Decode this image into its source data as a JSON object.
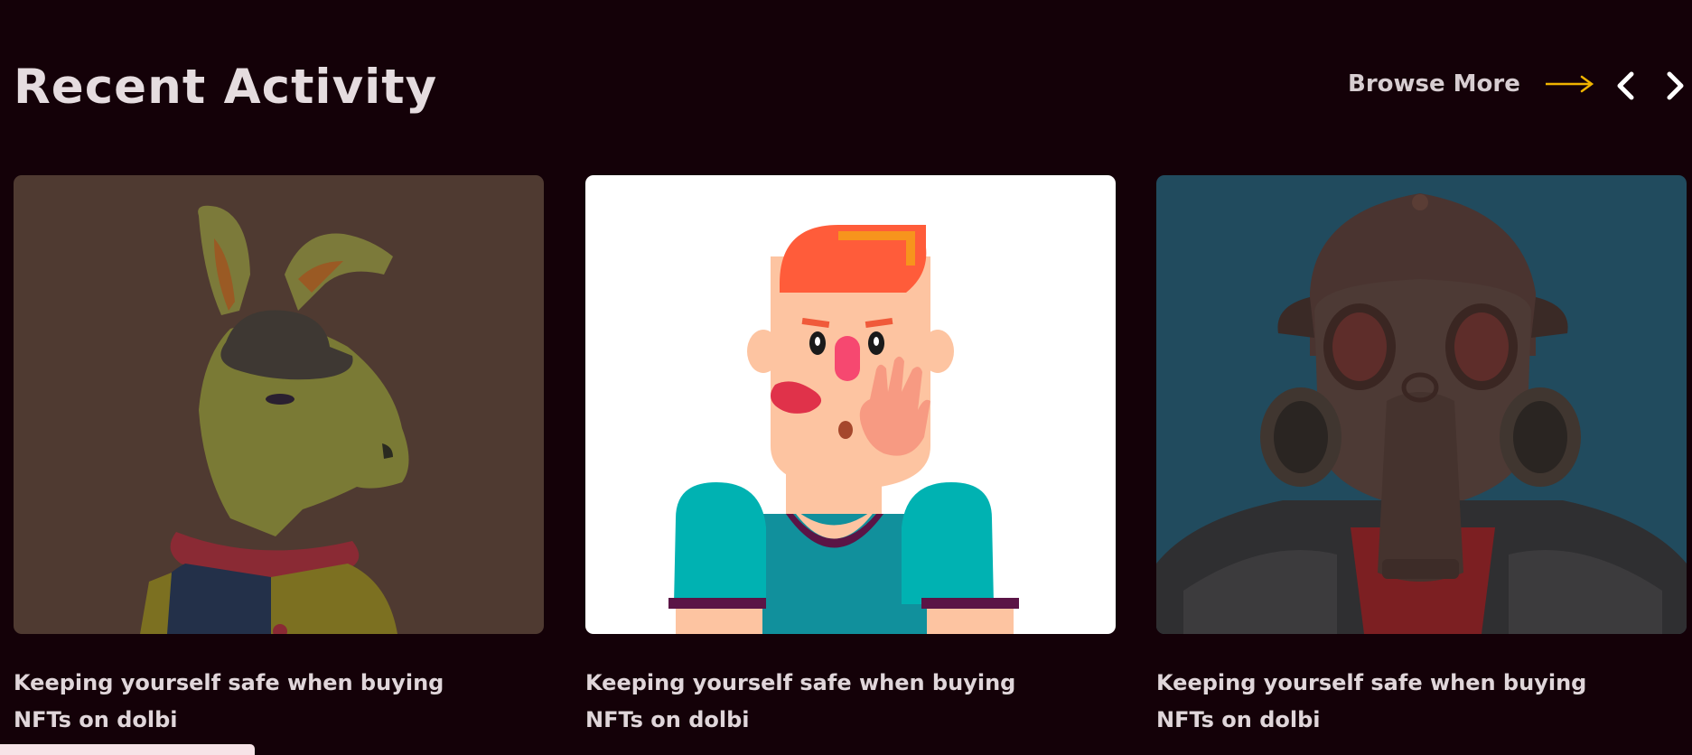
{
  "section": {
    "title": "Recent Activity",
    "browse_more_label": "Browse More",
    "accent_color": "#f0b400"
  },
  "icons": {
    "browse_arrow": "long-right-arrow-icon",
    "prev": "chevron-left-icon",
    "next": "chevron-right-icon"
  },
  "cards": [
    {
      "title": "Keeping yourself safe when buying NFTs on dolbi",
      "image": "rabbit-nft-artwork"
    },
    {
      "title": "Keeping yourself safe when buying NFTs on dolbi",
      "image": "cartoon-man-nft-artwork"
    },
    {
      "title": "Keeping yourself safe when buying NFTs on dolbi",
      "image": "gas-mask-nft-artwork"
    }
  ]
}
